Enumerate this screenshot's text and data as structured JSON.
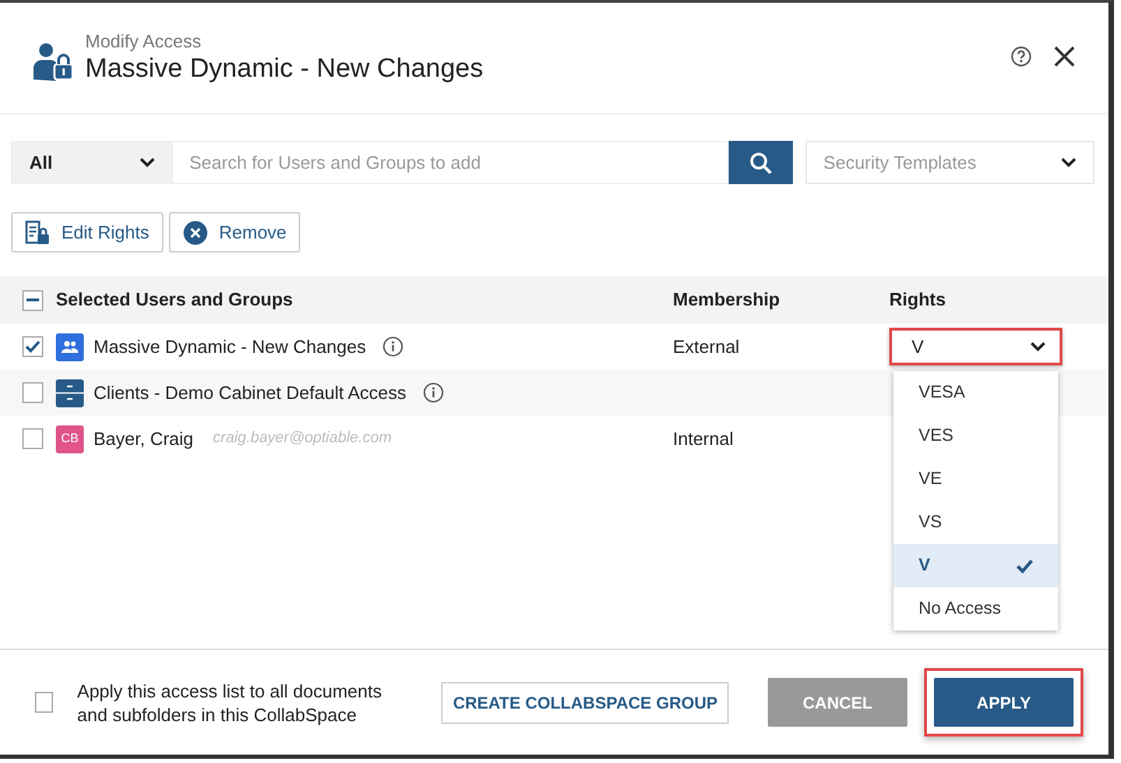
{
  "header": {
    "subtitle": "Modify Access",
    "title": "Massive Dynamic - New Changes"
  },
  "search": {
    "scope": "All",
    "placeholder": "Search for Users and Groups to add",
    "templates_placeholder": "Security Templates"
  },
  "toolbar": [
    {
      "label": "Edit Rights",
      "kind": "edit"
    },
    {
      "label": "Remove",
      "kind": "remove"
    }
  ],
  "table": {
    "select_all_indeterminate": true,
    "columns": [
      "Selected Users and Groups",
      "Membership",
      "Rights"
    ],
    "rows": [
      {
        "kind": "group",
        "name": "Massive Dynamic - New Changes",
        "info": true,
        "membership": "External",
        "checked": true,
        "rights": "V",
        "rights_highlighted": true
      },
      {
        "kind": "cabinet",
        "name": "Clients - Demo Cabinet Default Access",
        "info": true,
        "checked": false
      },
      {
        "kind": "user",
        "initials": "CB",
        "name": "Bayer, Craig",
        "email": "craig.bayer@optiable.com",
        "membership": "Internal",
        "checked": false
      }
    ]
  },
  "rights_menu": {
    "options": [
      {
        "label": "VESA",
        "selected": false
      },
      {
        "label": "VES",
        "selected": false
      },
      {
        "label": "VE",
        "selected": false
      },
      {
        "label": "VS",
        "selected": false
      },
      {
        "label": "V",
        "selected": true
      },
      {
        "label": "No Access",
        "selected": false
      }
    ]
  },
  "footer": {
    "apply_all": {
      "checked": false,
      "label": "Apply this access list to all documents and subfolders in this CollabSpace"
    },
    "buttons": [
      {
        "label": "CREATE COLLABSPACE GROUP",
        "kind": "outline",
        "highlighted": false
      },
      {
        "label": "CANCEL",
        "kind": "secondary",
        "highlighted": false
      },
      {
        "label": "APPLY",
        "kind": "primary",
        "highlighted": true
      }
    ]
  }
}
